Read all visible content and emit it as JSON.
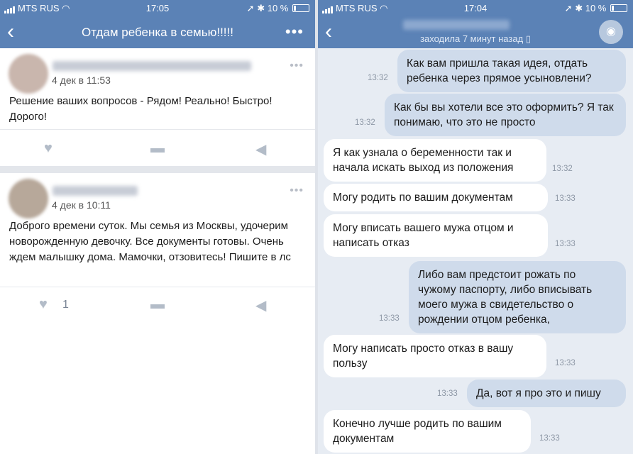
{
  "left": {
    "status": {
      "carrier": "MTS RUS",
      "time": "17:05",
      "battery": "10 %"
    },
    "nav": {
      "back": "‹",
      "title": "Отдам ребенка в семью!!!!!",
      "more": "•••"
    },
    "posts": [
      {
        "date": "4 дек в 11:53",
        "text": "Решение ваших вопросов - Рядом! Реально! Быстро! Дорого!",
        "likes": ""
      },
      {
        "date": "4 дек в 10:11",
        "text": "Доброго времени суток. Мы семья из Москвы, удочерим новорожденную девочку. Все документы готовы.  Очень ждем малышку дома. Мамочки, отзовитесь! Пишите в лс",
        "likes": "1"
      }
    ]
  },
  "right": {
    "status": {
      "carrier": "MTS RUS",
      "time": "17:04",
      "battery": "10 %"
    },
    "header": {
      "back": "‹",
      "subtitle": "заходила 7 минут назад"
    },
    "messages": [
      {
        "dir": "out",
        "text": "Как вам пришла такая идея, отдать ребенка через прямое усыновлени?",
        "time": "13:32"
      },
      {
        "dir": "out",
        "text": "Как бы вы хотели все это оформить? Я так понимаю, что это не просто",
        "time": "13:32"
      },
      {
        "dir": "in",
        "text": "Я как узнала о беременности так и начала искать выход из положения",
        "time": "13:32"
      },
      {
        "dir": "in",
        "text": "Могу родить по вашим документам",
        "time": "13:33"
      },
      {
        "dir": "in",
        "text": "Могу вписать вашего мужа отцом и написать отказ",
        "time": "13:33"
      },
      {
        "dir": "out",
        "text": "Либо вам предстоит рожать по чужому паспорту, либо вписывать моего мужа в свидетельство о рождении отцом ребенка,",
        "time": "13:33"
      },
      {
        "dir": "in",
        "text": "Могу написать просто отказ в вашу пользу",
        "time": "13:33"
      },
      {
        "dir": "out",
        "text": "Да, вот я про это и пишу",
        "time": "13:33"
      },
      {
        "dir": "in",
        "text": "Конечно лучше родить по вашим документам",
        "time": "13:33"
      }
    ]
  },
  "colors": {
    "header": "#5b82b6",
    "outgoing_bubble": "#cfdbeb",
    "incoming_bubble": "#ffffff",
    "chat_bg": "#e7ecf3"
  },
  "icons": [
    "signal-icon",
    "wifi-icon",
    "location-icon",
    "bluetooth-icon",
    "battery-icon",
    "back-icon",
    "more-icon",
    "like-icon",
    "comment-icon",
    "share-icon",
    "camera-icon",
    "phone-icon"
  ]
}
